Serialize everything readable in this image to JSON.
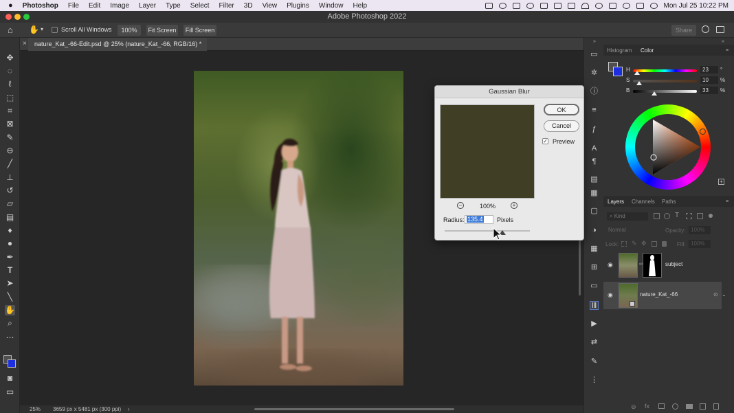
{
  "menubar": {
    "app": "Photoshop",
    "items": [
      "File",
      "Edit",
      "Image",
      "Layer",
      "Type",
      "Select",
      "Filter",
      "3D",
      "View",
      "Plugins",
      "Window",
      "Help"
    ],
    "clock": "Mon Jul 25  10:22 PM"
  },
  "window": {
    "title": "Adobe Photoshop 2022"
  },
  "options": {
    "scroll_all_windows": "Scroll All Windows",
    "zoom": "100%",
    "fit_screen": "Fit Screen",
    "fill_screen": "Fill Screen",
    "share": "Share"
  },
  "document": {
    "tab_title": "nature_Kat_-66-Edit.psd @ 25% (nature_Kat_-66, RGB/16) *",
    "tab_close": "×"
  },
  "status": {
    "zoom": "25%",
    "info": "3659 px x 5481 px (300 ppi)",
    "arrow": "›"
  },
  "color_panel": {
    "tabs": [
      "Histogram",
      "Color"
    ],
    "active_tab": "Color",
    "h": {
      "label": "H",
      "value": "23",
      "unit": "°",
      "level": 0.064
    },
    "s": {
      "label": "S",
      "value": "10",
      "unit": "%",
      "level": 0.1
    },
    "b": {
      "label": "B",
      "value": "33",
      "unit": "%",
      "level": 0.33
    },
    "foreground": "#4f4f4f",
    "background": "#1d2ee0"
  },
  "layers_panel": {
    "tabs": [
      "Layers",
      "Channels",
      "Paths"
    ],
    "active_tab": "Layers",
    "filter_placeholder": "Kind",
    "blend_mode": "Normal",
    "opacity_label": "Opacity:",
    "opacity_value": "100%",
    "lock_label": "Lock:",
    "fill_label": "Fill:",
    "fill_value": "100%",
    "layers": [
      {
        "name": "subject",
        "visible": true,
        "has_mask": true
      },
      {
        "name": "nature_Kat_-66",
        "visible": true,
        "has_mask": false
      }
    ]
  },
  "gaussian_blur": {
    "title": "Gaussian Blur",
    "ok": "OK",
    "cancel": "Cancel",
    "preview_label": "Preview",
    "preview_checked": true,
    "zoom": "100%",
    "radius_label": "Radius:",
    "radius_value": "135.4",
    "radius_unit": "Pixels",
    "slider_level": 0.68
  }
}
